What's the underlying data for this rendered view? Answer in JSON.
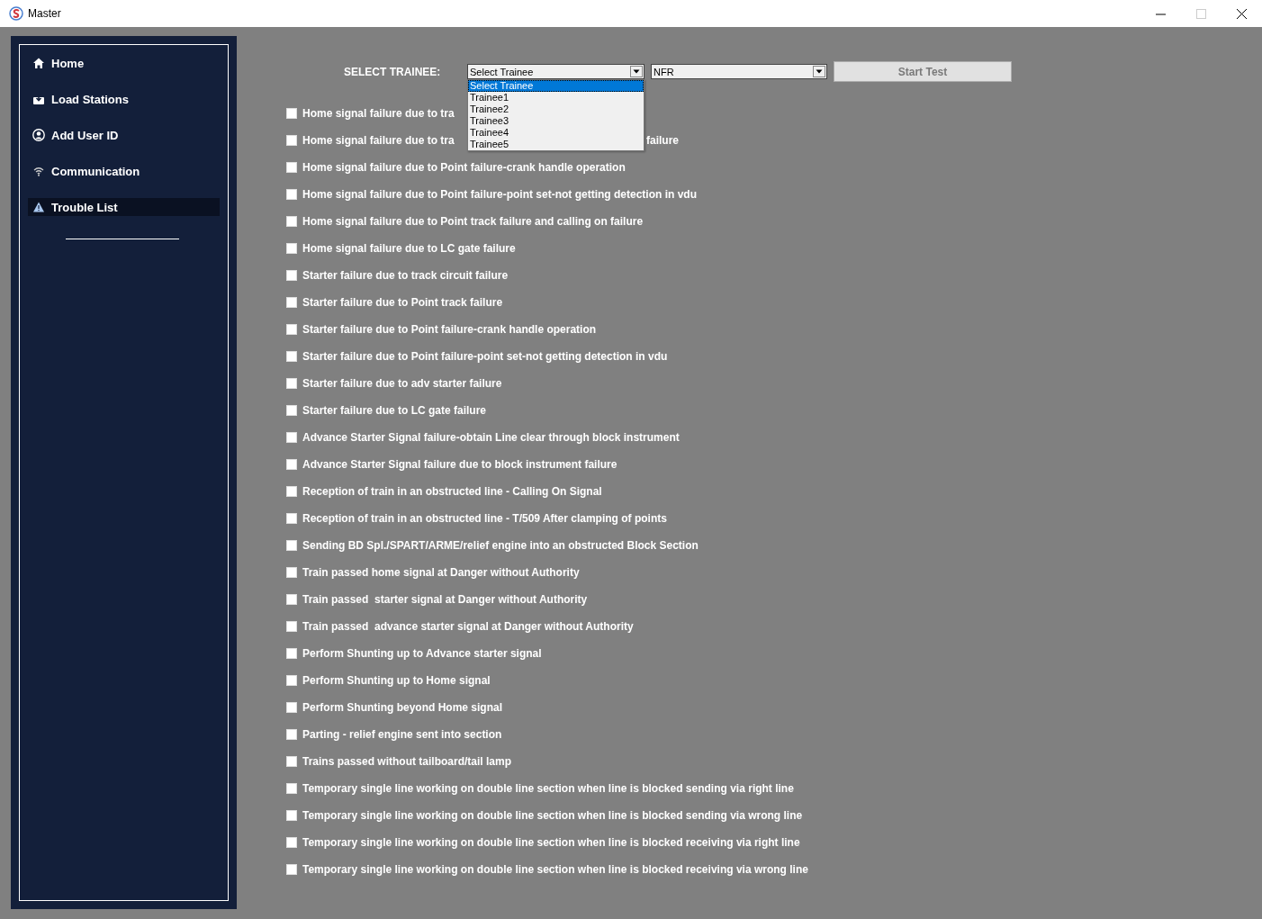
{
  "window": {
    "title": "Master"
  },
  "sidebar": {
    "items": [
      {
        "label": "Home",
        "selected": false
      },
      {
        "label": "Load Stations",
        "selected": false
      },
      {
        "label": "Add User ID",
        "selected": false
      },
      {
        "label": "Communication",
        "selected": false
      },
      {
        "label": "Trouble List",
        "selected": true
      }
    ]
  },
  "header": {
    "label": "SELECT TRAINEE:",
    "trainee_select": {
      "value": "Select Trainee",
      "expanded": true,
      "options": [
        {
          "label": "Select Trainee",
          "selected": true
        },
        {
          "label": "Trainee1",
          "selected": false
        },
        {
          "label": "Trainee2",
          "selected": false
        },
        {
          "label": "Trainee3",
          "selected": false
        },
        {
          "label": "Trainee4",
          "selected": false
        },
        {
          "label": "Trainee5",
          "selected": false
        }
      ]
    },
    "mode_select": {
      "value": "NFR"
    },
    "start_button": {
      "label": "Start Test",
      "disabled": true
    }
  },
  "troubles": [
    {
      "label": "Home signal failure due to tra",
      "checked": false
    },
    {
      "label": "Home signal failure due to tra",
      "tail": "failure",
      "checked": false
    },
    {
      "label": "Home signal failure due to Point failure-crank handle operation",
      "checked": false
    },
    {
      "label": "Home signal failure due to Point failure-point set-not getting detection in vdu",
      "checked": false
    },
    {
      "label": "Home signal failure due to Point track failure and calling on failure",
      "checked": false
    },
    {
      "label": "Home signal failure due to LC gate failure",
      "checked": false
    },
    {
      "label": "Starter failure due to track circuit failure",
      "checked": false
    },
    {
      "label": "Starter failure due to Point track failure",
      "checked": false
    },
    {
      "label": "Starter failure due to Point failure-crank handle operation",
      "checked": false
    },
    {
      "label": "Starter failure due to Point failure-point set-not getting detection in vdu",
      "checked": false
    },
    {
      "label": "Starter failure due to adv starter failure",
      "checked": false
    },
    {
      "label": "Starter failure due to LC gate failure",
      "checked": false
    },
    {
      "label": "Advance Starter Signal failure-obtain Line clear through block instrument",
      "checked": false
    },
    {
      "label": "Advance Starter Signal failure due to block instrument failure",
      "checked": false
    },
    {
      "label": "Reception of train in an obstructed line - Calling On Signal",
      "checked": false
    },
    {
      "label": "Reception of train in an obstructed line - T/509 After clamping of points",
      "checked": false
    },
    {
      "label": "Sending BD Spl./SPART/ARME/relief engine into an obstructed Block Section",
      "checked": false
    },
    {
      "label": "Train passed home signal at Danger without Authority",
      "checked": false
    },
    {
      "label": "Train passed  starter signal at Danger without Authority",
      "checked": false
    },
    {
      "label": "Train passed  advance starter signal at Danger without Authority",
      "checked": false
    },
    {
      "label": "Perform Shunting up to Advance starter signal",
      "checked": false
    },
    {
      "label": "Perform Shunting up to Home signal",
      "checked": false
    },
    {
      "label": "Perform Shunting beyond Home signal",
      "checked": false
    },
    {
      "label": "Parting - relief engine sent into section",
      "checked": false
    },
    {
      "label": "Trains passed without tailboard/tail lamp",
      "checked": false
    },
    {
      "label": "Temporary single line working on double line section when line is blocked sending via right line",
      "checked": false
    },
    {
      "label": "Temporary single line working on double line section when line is blocked sending via wrong line",
      "checked": false
    },
    {
      "label": "Temporary single line working on double line section when line is blocked receiving via right line",
      "checked": false
    },
    {
      "label": "Temporary single line working on double line section when line is blocked receiving via wrong line",
      "checked": false
    }
  ]
}
